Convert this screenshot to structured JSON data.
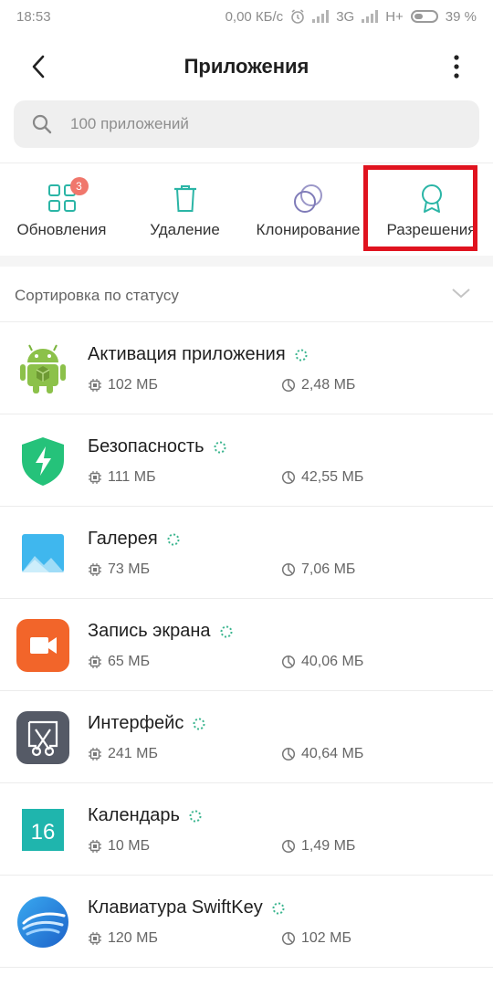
{
  "status": {
    "time": "18:53",
    "speed": "0,00 КБ/с",
    "net1": "3G",
    "net2": "H+",
    "battery": "39 %",
    "battery_level": 0.39
  },
  "header": {
    "title": "Приложения"
  },
  "search": {
    "placeholder": "100 приложений"
  },
  "tabs": [
    {
      "label": "Обновления",
      "icon": "grid-icon",
      "badge": "3"
    },
    {
      "label": "Удаление",
      "icon": "trash-icon"
    },
    {
      "label": "Клонирование",
      "icon": "clone-icon"
    },
    {
      "label": "Разрешения",
      "icon": "badge-icon"
    }
  ],
  "sort": {
    "label": "Сортировка по статусу"
  },
  "apps": [
    {
      "name": "Активация приложения",
      "ram": "102 МБ",
      "storage": "2,48 МБ",
      "icon": "android-icon"
    },
    {
      "name": "Безопасность",
      "ram": "111 МБ",
      "storage": "42,55 МБ",
      "icon": "shield-icon"
    },
    {
      "name": "Галерея",
      "ram": "73 МБ",
      "storage": "7,06 МБ",
      "icon": "gallery-icon"
    },
    {
      "name": "Запись экрана",
      "ram": "65 МБ",
      "storage": "40,06 МБ",
      "icon": "video-camera-icon"
    },
    {
      "name": "Интерфейс",
      "ram": "241 МБ",
      "storage": "40,64 МБ",
      "icon": "scissors-icon"
    },
    {
      "name": "Календарь",
      "ram": "10 МБ",
      "storage": "1,49 МБ",
      "icon": "calendar-icon",
      "icon_text": "16"
    },
    {
      "name": "Клавиатура SwiftKey",
      "ram": "120 МБ",
      "storage": "102 МБ",
      "icon": "swiftkey-icon"
    }
  ],
  "colors": {
    "accent": "#2bb5a6",
    "highlight": "#e0131f",
    "badge": "#f0776c"
  }
}
